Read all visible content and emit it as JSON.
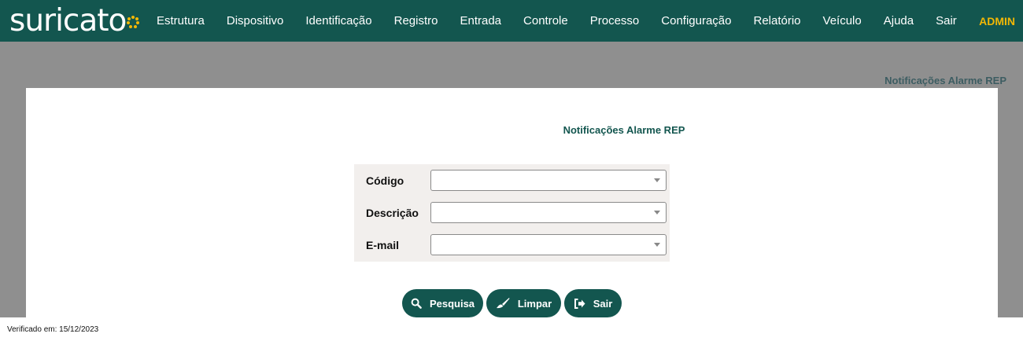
{
  "brand": {
    "name": "suricato",
    "accent": "#f2b705",
    "primary": "#13564f"
  },
  "menu": [
    {
      "label": "Estrutura"
    },
    {
      "label": "Dispositivo"
    },
    {
      "label": "Identificação"
    },
    {
      "label": "Registro"
    },
    {
      "label": "Entrada"
    },
    {
      "label": "Controle"
    },
    {
      "label": "Processo"
    },
    {
      "label": "Configuração"
    },
    {
      "label": "Relatório"
    },
    {
      "label": "Veículo"
    },
    {
      "label": "Ajuda"
    },
    {
      "label": "Sair"
    }
  ],
  "user": {
    "name": "ADMIN"
  },
  "page": {
    "background_title": "Notificações Alarme REP"
  },
  "modal": {
    "title": "Notificações Alarme REP",
    "fields": [
      {
        "label": "Código",
        "value": ""
      },
      {
        "label": "Descrição",
        "value": ""
      },
      {
        "label": "E-mail",
        "value": ""
      }
    ],
    "buttons": {
      "search": "Pesquisa",
      "clear": "Limpar",
      "exit": "Sair"
    }
  },
  "footer": {
    "verified": "Verificado em: 15/12/2023"
  }
}
